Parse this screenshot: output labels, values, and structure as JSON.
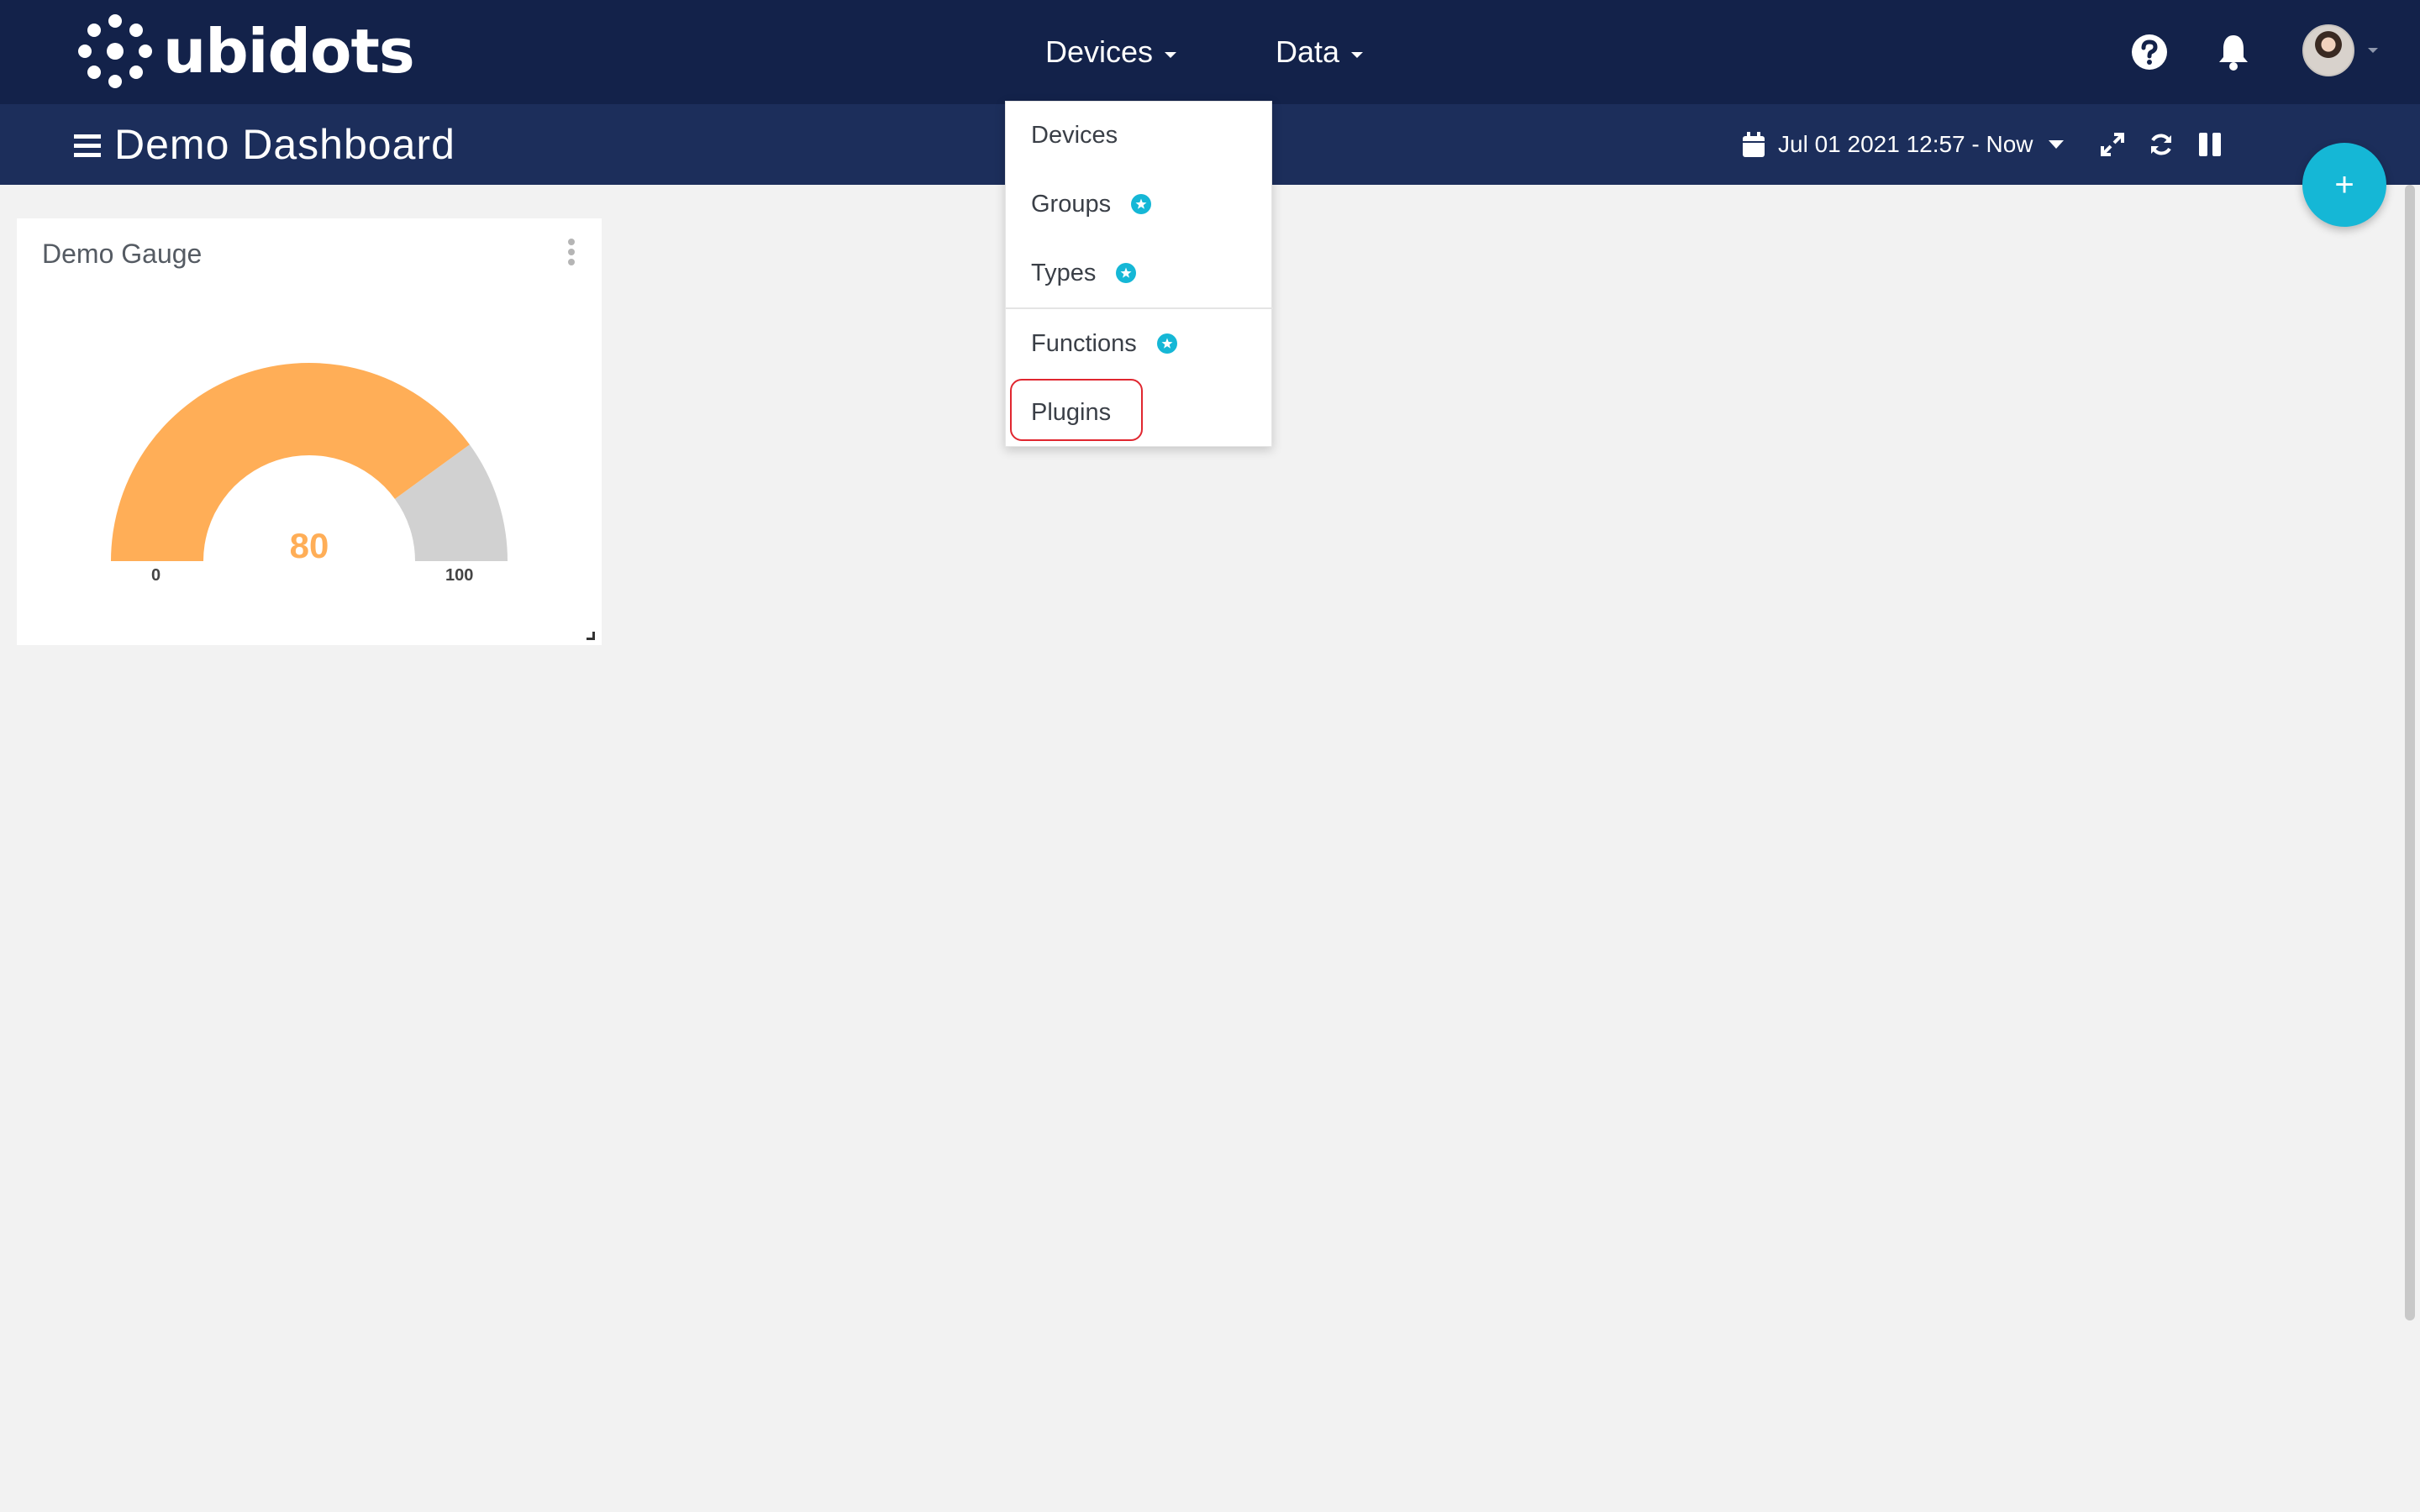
{
  "brand": {
    "name": "ubidots",
    "logo_icon": "ubidots-dots-logo"
  },
  "nav": {
    "devices_label": "Devices",
    "data_label": "Data",
    "help_icon": "question-circle-icon",
    "bell_icon": "bell-icon",
    "avatar_icon": "user-avatar"
  },
  "dashboard": {
    "title": "Demo Dashboard",
    "date_range": "Jul 01 2021 12:57 - Now",
    "tools": [
      "calendar-icon",
      "expand-icon",
      "refresh-icon",
      "pause-icon"
    ],
    "fab_label": "+"
  },
  "devices_menu": {
    "items": [
      {
        "label": "Devices",
        "badge": false
      },
      {
        "label": "Groups",
        "badge": true
      },
      {
        "label": "Types",
        "badge": true
      },
      {
        "label": "Functions",
        "badge": true
      },
      {
        "label": "Plugins",
        "badge": false,
        "highlighted": true
      }
    ]
  },
  "widget": {
    "title": "Demo Gauge",
    "value": "80",
    "min": "0",
    "max": "100",
    "fill_fraction": 0.8,
    "colors": {
      "value": "#ffae57",
      "rest": "#d1d1d1"
    }
  },
  "colors": {
    "navbar": "#13224a",
    "dashbar": "#1c2e5b",
    "accent": "#15b7d6",
    "highlight": "#e0262f",
    "background": "#f2f2f2"
  }
}
